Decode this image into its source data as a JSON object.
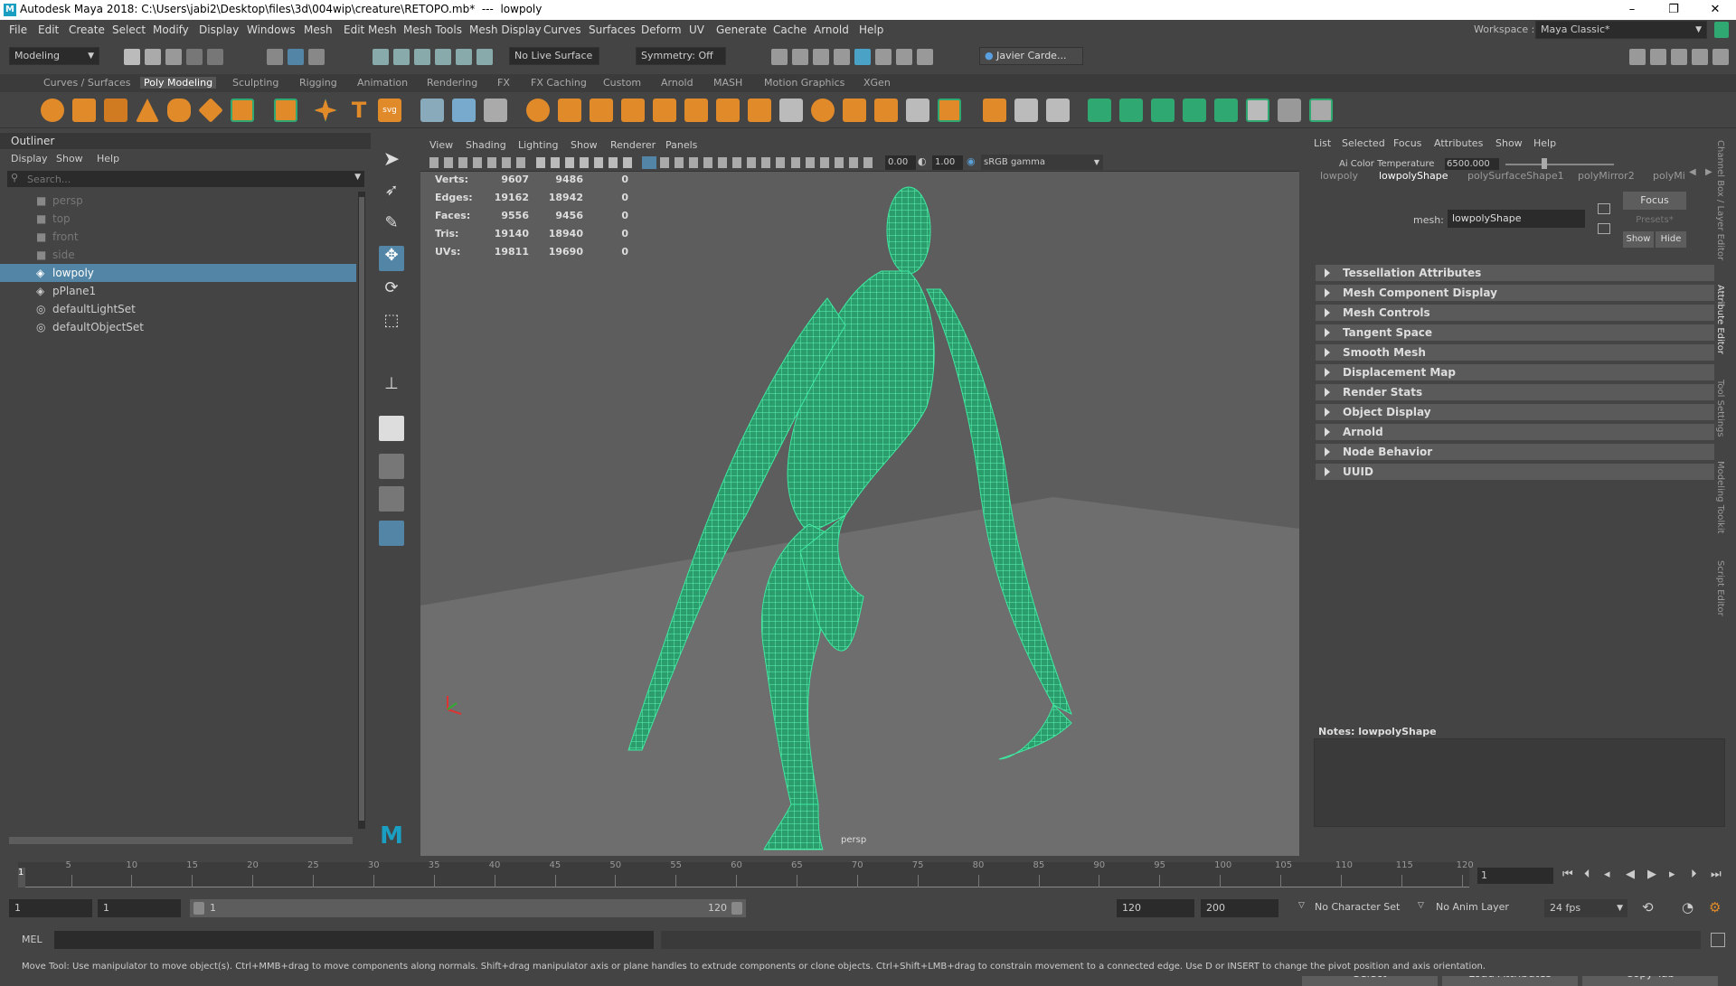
{
  "window": {
    "title": "Autodesk Maya 2018: C:\\Users\\jabi2\\Desktop\\files\\3d\\004wip\\creature\\RETOPO.mb*  ---  lowpoly",
    "min": "–",
    "max": "❐",
    "close": "✕"
  },
  "menubar": {
    "items": [
      "File",
      "Edit",
      "Create",
      "Select",
      "Modify",
      "Display",
      "Windows",
      "Mesh",
      "Edit Mesh",
      "Mesh Tools",
      "Mesh Display",
      "Curves",
      "Surfaces",
      "Deform",
      "UV",
      "Generate",
      "Cache",
      "Arnold",
      "Help"
    ],
    "workspace_label": "Workspace :",
    "workspace_value": "Maya Classic*"
  },
  "statusline": {
    "mode": "Modeling",
    "live_surface": "No Live Surface",
    "symmetry": "Symmetry: Off",
    "user": "Javier Carde..."
  },
  "shelf": {
    "tabs": [
      "Curves / Surfaces",
      "Poly Modeling",
      "Sculpting",
      "Rigging",
      "Animation",
      "Rendering",
      "FX",
      "FX Caching",
      "Custom",
      "Arnold",
      "MASH",
      "Motion Graphics",
      "XGen"
    ],
    "active": "Poly Modeling"
  },
  "outliner": {
    "title": "Outliner",
    "menu": [
      "Display",
      "Show",
      "Help"
    ],
    "search_placeholder": "Search...",
    "items": [
      {
        "label": "persp",
        "dim": true
      },
      {
        "label": "top",
        "dim": true
      },
      {
        "label": "front",
        "dim": true
      },
      {
        "label": "side",
        "dim": true
      },
      {
        "label": "lowpoly",
        "selected": true
      },
      {
        "label": "pPlane1"
      },
      {
        "label": "defaultLightSet"
      },
      {
        "label": "defaultObjectSet"
      }
    ]
  },
  "viewport": {
    "menu": [
      "View",
      "Shading",
      "Lighting",
      "Show",
      "Renderer",
      "Panels"
    ],
    "exposure": "0.00",
    "gamma": "1.00",
    "color_space": "sRGB gamma",
    "camera": "persp",
    "hud": [
      {
        "label": "Verts:",
        "a": "9607",
        "b": "9486",
        "c": "0"
      },
      {
        "label": "Edges:",
        "a": "19162",
        "b": "18942",
        "c": "0"
      },
      {
        "label": "Faces:",
        "a": "9556",
        "b": "9456",
        "c": "0"
      },
      {
        "label": "Tris:",
        "a": "19140",
        "b": "18940",
        "c": "0"
      },
      {
        "label": "UVs:",
        "a": "19811",
        "b": "19690",
        "c": "0"
      }
    ]
  },
  "attr": {
    "menu": [
      "List",
      "Selected",
      "Focus",
      "Attributes",
      "Show",
      "Help"
    ],
    "ai_temp_label": "Ai Color Temperature",
    "ai_temp_value": "6500.000",
    "node_tabs": [
      "lowpoly",
      "lowpolyShape",
      "polySurfaceShape1",
      "polyMirror2",
      "polyMi"
    ],
    "active_tab": "lowpolyShape",
    "mesh_label": "mesh:",
    "mesh_value": "lowpolyShape",
    "focus": "Focus",
    "presets": "Presets*",
    "show": "Show",
    "hide": "Hide",
    "sections": [
      "Tessellation Attributes",
      "Mesh Component Display",
      "Mesh Controls",
      "Tangent Space",
      "Smooth Mesh",
      "Displacement Map",
      "Render Stats",
      "Object Display",
      "Arnold",
      "Node Behavior",
      "UUID"
    ],
    "notes_label": "Notes:  lowpolyShape",
    "buttons": [
      "Select",
      "Load Attributes",
      "Copy Tab"
    ]
  },
  "side_tabs": [
    "Channel Box / Layer Editor",
    "Attribute Editor",
    "Tool Settings",
    "Modeling Toolkit",
    "Script Editor"
  ],
  "timeslider": {
    "ticks": [
      "5",
      "10",
      "15",
      "20",
      "25",
      "30",
      "35",
      "40",
      "45",
      "50",
      "55",
      "60",
      "65",
      "70",
      "75",
      "80",
      "85",
      "90",
      "95",
      "100",
      "105",
      "110",
      "115",
      "120"
    ],
    "current_marker": "1",
    "current_frame": "1"
  },
  "range": {
    "start": "1",
    "playback_start": "1",
    "range_left": "1",
    "range_right": "120",
    "playback_end": "120",
    "end": "200",
    "character_set": "No Character Set",
    "anim_layer": "No Anim Layer",
    "fps": "24 fps"
  },
  "cmdline": {
    "label": "MEL"
  },
  "helpline": "Move Tool: Use manipulator to move object(s). Ctrl+MMB+drag to move components along normals. Shift+drag manipulator axis or plane handles to extrude components or clone objects. Ctrl+Shift+LMB+drag to constrain movement to a connected edge. Use D or INSERT to change the pivot position and axis orientation.",
  "colors": {
    "accent": "#5285a6",
    "wire": "#3fe8a0",
    "shelf_orange": "#e08a2a",
    "shelf_green": "#2fa872"
  }
}
